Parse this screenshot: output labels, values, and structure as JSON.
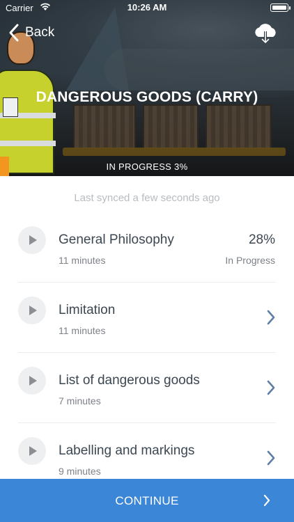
{
  "status_bar": {
    "carrier": "Carrier",
    "time": "10:26 AM"
  },
  "nav": {
    "back_label": "Back",
    "download_icon": "cloud-download-icon"
  },
  "course": {
    "title": "DANGEROUS GOODS (CARRY)",
    "progress_label": "IN PROGRESS 3%",
    "progress_fraction": 0.03,
    "progress_color": "#f2961f"
  },
  "sync_text": "Last synced a few seconds ago",
  "lessons": [
    {
      "title": "General Philosophy",
      "duration": "11 minutes",
      "percent": "28%",
      "status": "In Progress"
    },
    {
      "title": "Limitation",
      "duration": "11 minutes"
    },
    {
      "title": "List of dangerous goods",
      "duration": "7 minutes"
    },
    {
      "title": "Labelling and markings",
      "duration": "9 minutes"
    }
  ],
  "continue_label": "CONTINUE",
  "colors": {
    "accent": "#3b86d6",
    "text_primary": "#3c4752",
    "text_secondary": "#7d8288"
  }
}
